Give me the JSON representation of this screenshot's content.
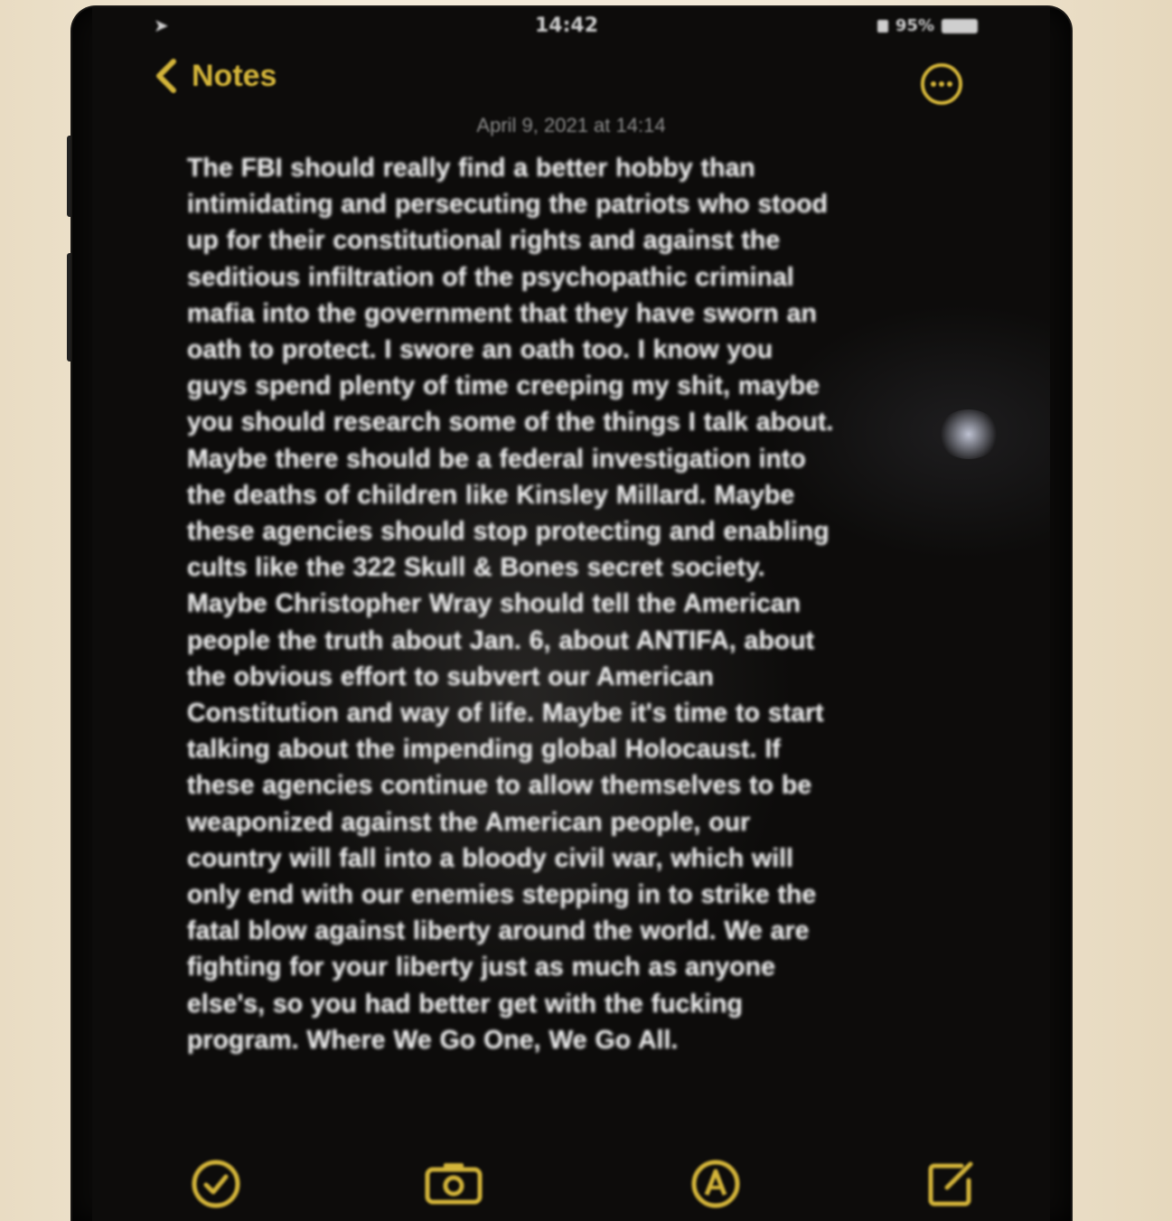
{
  "status_bar": {
    "time": "14:42",
    "battery_percent": "95%"
  },
  "nav": {
    "back_label": "Notes"
  },
  "note": {
    "date": "April 9, 2021 at 14:14",
    "lines": [
      "The FBI should really find a better hobby than",
      "intimidating and persecuting the patriots who stood",
      "up for their constitutional rights and against the",
      "seditious infiltration of the psychopathic criminal",
      "mafia into the government that they have sworn an",
      "oath to protect. I swore an oath too. I know you",
      "guys spend plenty of time creeping my shit, maybe",
      "you should research some of the things I talk about.",
      "Maybe there should be a federal investigation into",
      "the deaths of children like Kinsley Millard. Maybe",
      "these agencies should stop protecting and enabling",
      "cults like the 322 Skull & Bones secret society.",
      "Maybe Christopher Wray should tell the American",
      "people the truth about Jan. 6, about ANTIFA, about",
      "the obvious effort to subvert our American",
      "Constitution and way of life. Maybe it's time to start",
      "talking about the impending global Holocaust. If",
      "these agencies continue to allow themselves to be",
      "weaponized against the American people, our",
      "country will fall into a bloody civil war, which will",
      "only end with our enemies stepping in to strike the",
      "fatal blow against liberty around the world. We are",
      "fighting for your liberty just as much as anyone",
      "else's, so you had better get with the fucking",
      "program. Where We Go One, We Go All."
    ]
  },
  "colors": {
    "accent": "#d4b53a",
    "text": "#ececec",
    "background": "#0d0c0b"
  },
  "icons": {
    "back": "chevron-left-icon",
    "more": "ellipsis-circle-icon",
    "checklist": "checklist-icon",
    "camera": "camera-icon",
    "markup": "markup-pen-icon",
    "compose": "compose-icon"
  }
}
